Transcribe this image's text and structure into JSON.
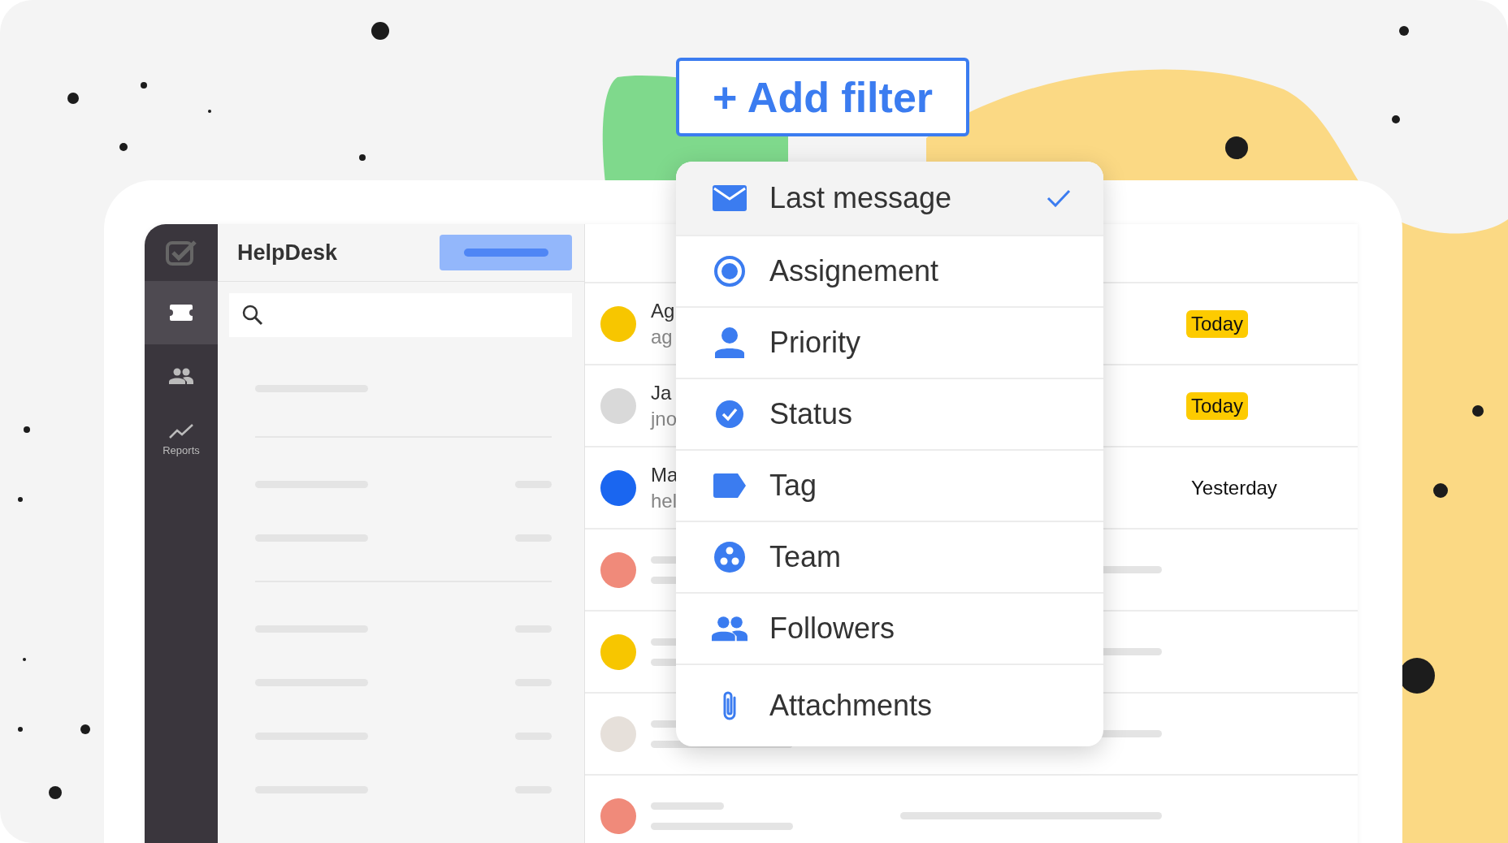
{
  "add_filter_button": "+ Add filter",
  "app": {
    "title": "HelpDesk",
    "sidebar": [
      {
        "kind": "ticket",
        "selected": true
      },
      {
        "kind": "people",
        "selected": false
      },
      {
        "kind": "chart",
        "label": "Reports",
        "selected": false
      }
    ],
    "rows": [
      {
        "kind": "ticket",
        "name": "Ag",
        "email": "ag",
        "date": "Today",
        "highlight": true,
        "color": "#f7c600"
      },
      {
        "kind": "ticket",
        "name": "Ja",
        "email": "jno",
        "date": "Today",
        "highlight": true,
        "color": "#d9d9d9"
      },
      {
        "kind": "ticket",
        "name": "Ma",
        "email": "hel",
        "date": "Yesterday",
        "highlight": false,
        "color": "#1a66f0"
      },
      {
        "kind": "placeholder",
        "color": "#f08a7a"
      },
      {
        "kind": "placeholder",
        "color": "#f7c600"
      },
      {
        "kind": "placeholder",
        "color": "#e6e0da"
      },
      {
        "kind": "placeholder",
        "color": "#f08a7a"
      }
    ]
  },
  "filter_menu": [
    {
      "kind": "mail",
      "label": "Last message",
      "selected": true
    },
    {
      "kind": "radio",
      "label": "Assignement",
      "selected": false
    },
    {
      "kind": "person",
      "label": "Priority",
      "selected": false
    },
    {
      "kind": "check",
      "label": "Status",
      "selected": false
    },
    {
      "kind": "tag",
      "label": "Tag",
      "selected": false
    },
    {
      "kind": "team",
      "label": "Team",
      "selected": false
    },
    {
      "kind": "people",
      "label": "Followers",
      "selected": false
    },
    {
      "kind": "clip",
      "label": "Attachments",
      "selected": false
    }
  ]
}
